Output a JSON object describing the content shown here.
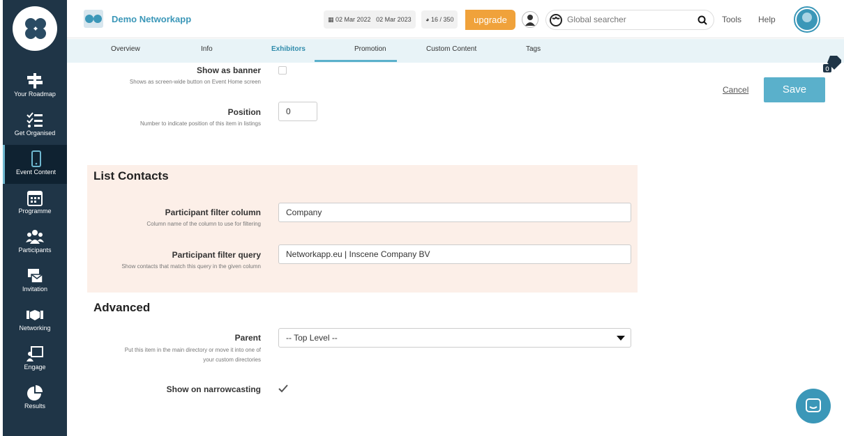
{
  "app": {
    "brand": "Demo Networkapp"
  },
  "sidebar": {
    "items": [
      {
        "label": "Your Roadmap",
        "icon": "signpost-icon"
      },
      {
        "label": "Get Organised",
        "icon": "checklist-icon"
      },
      {
        "label": "Event Content",
        "icon": "mobile-icon",
        "active": true
      },
      {
        "label": "Programme",
        "icon": "calendar-icon"
      },
      {
        "label": "Participants",
        "icon": "users-icon"
      },
      {
        "label": "Invitation",
        "icon": "invitation-icon"
      },
      {
        "label": "Networking",
        "icon": "handshake-icon"
      },
      {
        "label": "Engage",
        "icon": "presentation-icon"
      },
      {
        "label": "Results",
        "icon": "pie-chart-icon"
      }
    ]
  },
  "topbar": {
    "date_start": "02 Mar 2022",
    "date_end": "02 Mar 2023",
    "usage": "16 / 350",
    "upgrade_label": "upgrade",
    "search_placeholder": "Global searcher",
    "tools_label": "Tools",
    "help_label": "Help"
  },
  "tabs": [
    {
      "label": "Overview"
    },
    {
      "label": "Info"
    },
    {
      "label": "Exhibitors",
      "active": true
    },
    {
      "label": "Promotion"
    },
    {
      "label": "Custom Content"
    },
    {
      "label": "Tags"
    }
  ],
  "tags_count": "0",
  "actions": {
    "cancel_label": "Cancel",
    "save_label": "Save"
  },
  "form": {
    "show_as_banner": {
      "label": "Show as banner",
      "help": "Shows as screen-wide button on Event Home screen",
      "checked": false
    },
    "position": {
      "label": "Position",
      "help": "Number to indicate position of this item in listings",
      "value": "0"
    },
    "list_contacts": {
      "title": "List Contacts",
      "filter_column": {
        "label": "Participant filter column",
        "help": "Column name of the column to use for filtering",
        "value": "Company"
      },
      "filter_query": {
        "label": "Participant filter query",
        "help": "Show contacts that match this query in the given column",
        "value": "Networkapp.eu | Inscene Company BV"
      }
    },
    "advanced": {
      "title": "Advanced",
      "parent": {
        "label": "Parent",
        "help_line1": "Put this item in the main directory or move it into one of",
        "help_line2": "your custom directories",
        "value": "-- Top Level --"
      },
      "narrowcasting": {
        "label": "Show on narrowcasting",
        "checked": true
      }
    }
  },
  "colors": {
    "sidebar": "#1f3547",
    "accent": "#5ab0cb",
    "upgrade": "#f0a23b",
    "section_bg": "#fcefe8"
  }
}
